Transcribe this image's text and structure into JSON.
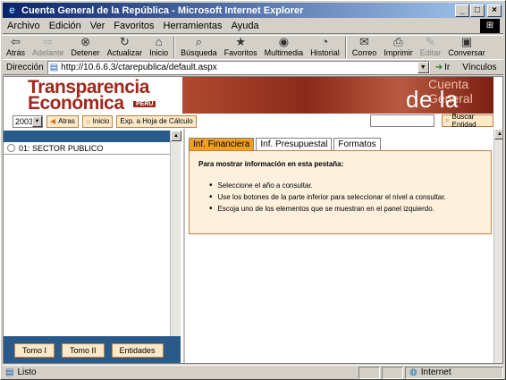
{
  "window": {
    "title": "Cuenta General de la República - Microsoft Internet Explorer",
    "minimize": "_",
    "maximize": "□",
    "close": "×"
  },
  "menu": {
    "items": [
      "Archivo",
      "Edición",
      "Ver",
      "Favoritos",
      "Herramientas",
      "Ayuda"
    ]
  },
  "toolbar": {
    "back": "Atrás",
    "forward": "Adelante",
    "stop": "Detener",
    "refresh": "Actualizar",
    "home": "Inicio",
    "search": "Búsqueda",
    "favorites": "Favoritos",
    "multimedia": "Multimedia",
    "history": "Historial",
    "mail": "Correo",
    "print": "Imprimir",
    "edit": "Editar",
    "discuss": "Conversar"
  },
  "address": {
    "label": "Dirección",
    "url": "http://10.6.6.3/ctarepublica/default.aspx",
    "go": "Ir",
    "links": "Vínculos"
  },
  "banner": {
    "brand_line1": "Transparencia",
    "brand_line2": "Económica",
    "brand_badge": "PERU",
    "title_line1": "Cuenta General",
    "title_line2": "de la República"
  },
  "controls": {
    "year": "2003",
    "back_label": "Atras",
    "home_label": "Inicio",
    "export_label": "Exp. a Hoja de Cálculo",
    "search_label": "Buscar Entidad"
  },
  "tree": {
    "items": [
      {
        "label": "01: SECTOR PUBLICO"
      }
    ]
  },
  "footer_buttons": [
    "Tomo I",
    "Tomo II",
    "Entidades"
  ],
  "tabs": [
    {
      "label": "Inf. Financiera",
      "active": true
    },
    {
      "label": "Inf. Presupuestal",
      "active": false
    },
    {
      "label": "Formatos",
      "active": false
    }
  ],
  "info": {
    "heading": "Para mostrar información en esta pestaña:",
    "bullets": [
      "Seleccione el año a consultar.",
      "Use los botones de la parte inferior para seleccionar el nivel a consultar.",
      "Escoja uno de los elementos que se muestran en el panel izquierdo."
    ]
  },
  "status": {
    "left": "Listo",
    "zone": "Internet"
  },
  "colors": {
    "titlebar_start": "#0a246a",
    "brand_red": "#a0281c",
    "panel_blue": "#2a5a8a",
    "active_tab": "#f0a020",
    "info_bg": "#fdf0dc"
  }
}
